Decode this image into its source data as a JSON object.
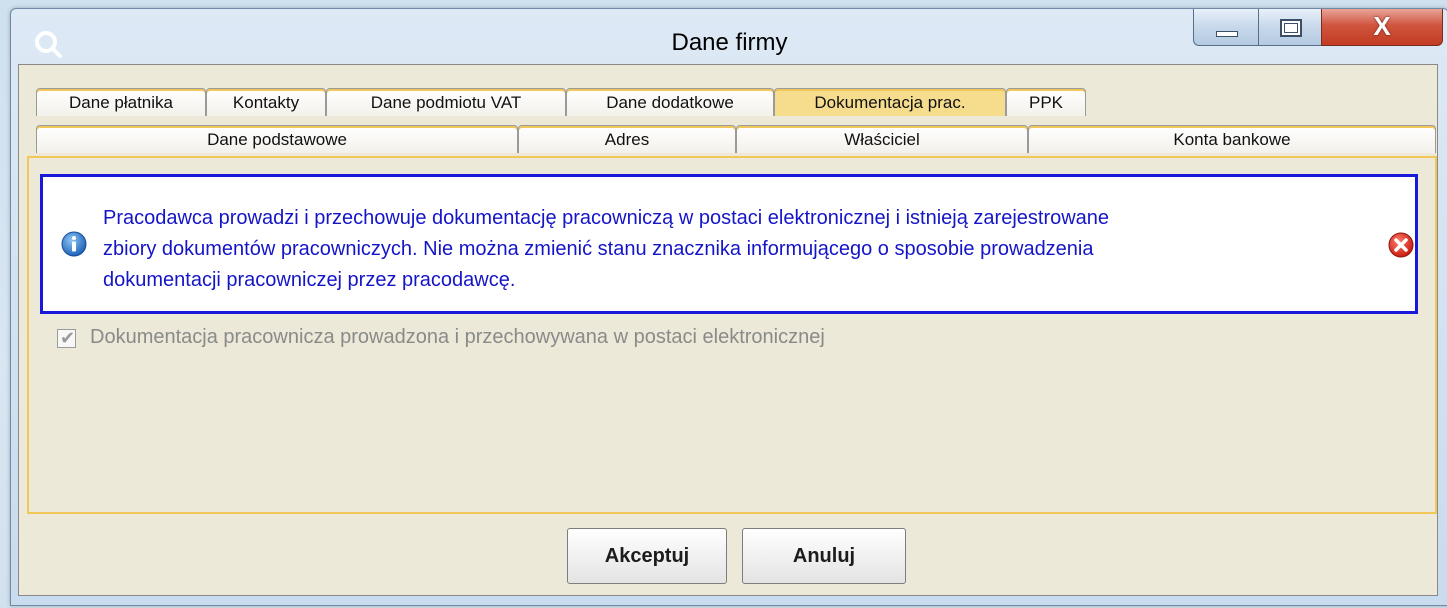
{
  "window": {
    "title": "Dane firmy",
    "close_label": "X"
  },
  "tabs_row1": [
    {
      "label": "Dane płatnika",
      "active": false
    },
    {
      "label": "Kontakty",
      "active": false
    },
    {
      "label": "Dane podmiotu VAT",
      "active": false
    },
    {
      "label": "Dane dodatkowe",
      "active": false
    },
    {
      "label": "Dokumentacja prac.",
      "active": true
    },
    {
      "label": "PPK",
      "active": false
    }
  ],
  "tabs_row2": [
    {
      "label": "Dane podstawowe"
    },
    {
      "label": "Adres"
    },
    {
      "label": "Właściciel"
    },
    {
      "label": "Konta bankowe"
    }
  ],
  "info": {
    "lines": [
      "Pracodawca prowadzi i przechowuje dokumentację pracowniczą w postaci elektronicznej i istnieją zarejestrowane",
      "zbiory dokumentów pracowniczych. Nie można zmienić stanu znacznika informującego o sposobie prowadzenia",
      "dokumentacji pracowniczej przez pracodawcę."
    ],
    "colors": {
      "text": "#1515c8",
      "border": "#1818d8"
    }
  },
  "checkbox": {
    "label": "Dokumentacja pracownicza prowadzona i przechowywana w postaci elektronicznej",
    "checked": true,
    "disabled": true
  },
  "buttons": {
    "accept": "Akceptuj",
    "cancel": "Anuluj"
  },
  "colors": {
    "tab_accent": "#f1c75a",
    "active_tab": "#f6dd8e",
    "panel_bg": "#ece9d8"
  }
}
